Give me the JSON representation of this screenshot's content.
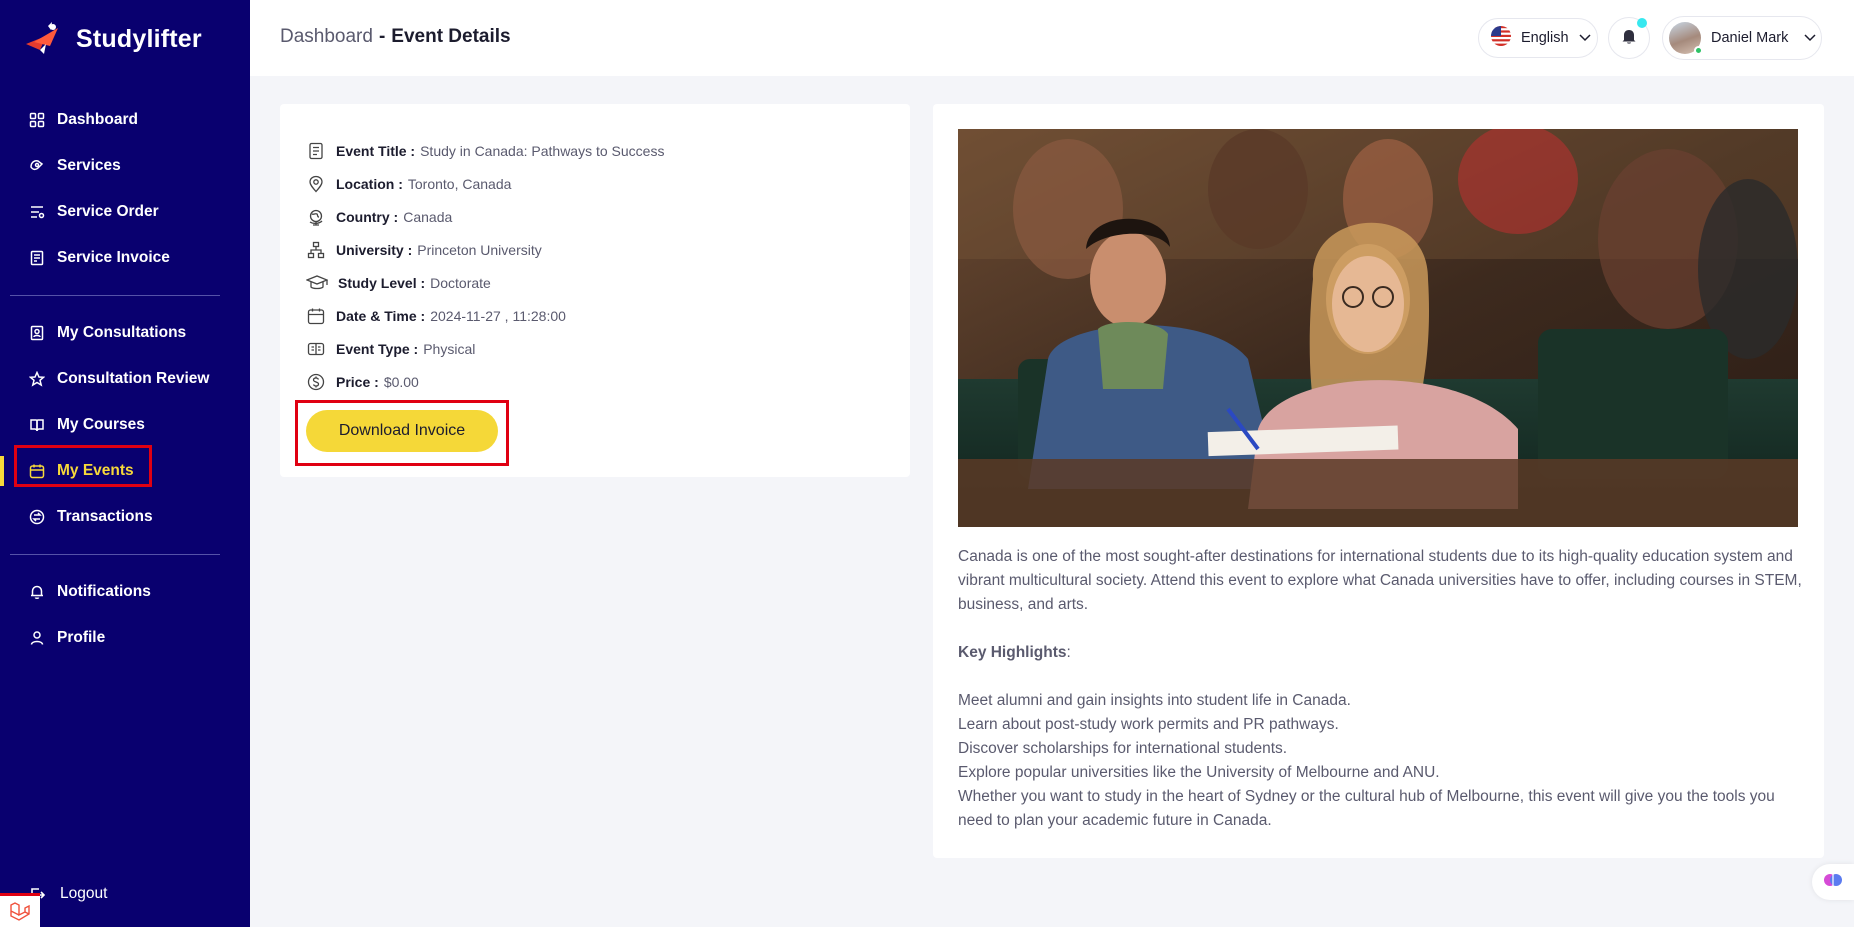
{
  "brand": {
    "name": "Studylifter"
  },
  "sidebar": {
    "groups": [
      [
        {
          "label": "Dashboard",
          "icon": "dashboard-icon"
        },
        {
          "label": "Services",
          "icon": "services-icon"
        },
        {
          "label": "Service Order",
          "icon": "order-icon"
        },
        {
          "label": "Service Invoice",
          "icon": "invoice-icon"
        }
      ],
      [
        {
          "label": "My Consultations",
          "icon": "consultation-icon"
        },
        {
          "label": "Consultation Review",
          "icon": "star-icon"
        },
        {
          "label": "My Courses",
          "icon": "book-icon"
        },
        {
          "label": "My Events",
          "icon": "calendar-icon",
          "active": true
        },
        {
          "label": "Transactions",
          "icon": "transactions-icon"
        }
      ],
      [
        {
          "label": "Notifications",
          "icon": "bell-icon"
        },
        {
          "label": "Profile",
          "icon": "user-icon"
        }
      ]
    ],
    "logout_label": "Logout"
  },
  "header": {
    "breadcrumb_root": "Dashboard",
    "breadcrumb_sep": "-",
    "breadcrumb_current": "Event Details",
    "language": "English",
    "user_name": "Daniel Mark"
  },
  "event": {
    "fields": [
      {
        "key": "Event Title :",
        "value": "Study in Canada: Pathways to Success",
        "icon": "document-icon"
      },
      {
        "key": "Location :",
        "value": "Toronto, Canada",
        "icon": "map-pin-icon"
      },
      {
        "key": "Country :",
        "value": "Canada",
        "icon": "globe-icon"
      },
      {
        "key": "University :",
        "value": "Princeton University",
        "icon": "hierarchy-icon"
      },
      {
        "key": "Study Level :",
        "value": "Doctorate",
        "icon": "graduation-cap-icon"
      },
      {
        "key": "Date & Time :",
        "value": "2024-11-27 , 11:28:00",
        "icon": "calendar-icon"
      },
      {
        "key": "Event Type :",
        "value": "Physical",
        "icon": "ticket-icon"
      },
      {
        "key": "Price :",
        "value": "$0.00",
        "icon": "dollar-circle-icon"
      }
    ],
    "download_label": "Download Invoice"
  },
  "description": {
    "intro": "Canada is one of the most sought-after destinations for international students due to its high-quality education system and vibrant multicultural society. Attend this event to explore what Canada universities have to offer, including courses in STEM, business, and arts.",
    "highlights_title": "Key Highlights",
    "highlights_colon": ":",
    "highlights": [
      "Meet alumni and gain insights into student life in Canada.",
      "Learn about post-study work permits and PR pathways.",
      "Discover scholarships for international students.",
      "Explore popular universities like the University of Melbourne and ANU.",
      "Whether you want to study in the heart of Sydney or the cultural hub of Melbourne, this event will give you the tools you need to plan your academic future in Canada."
    ]
  },
  "colors": {
    "sidebar": "#09006f",
    "accent": "#f5d838",
    "highlight": "#e00012"
  }
}
